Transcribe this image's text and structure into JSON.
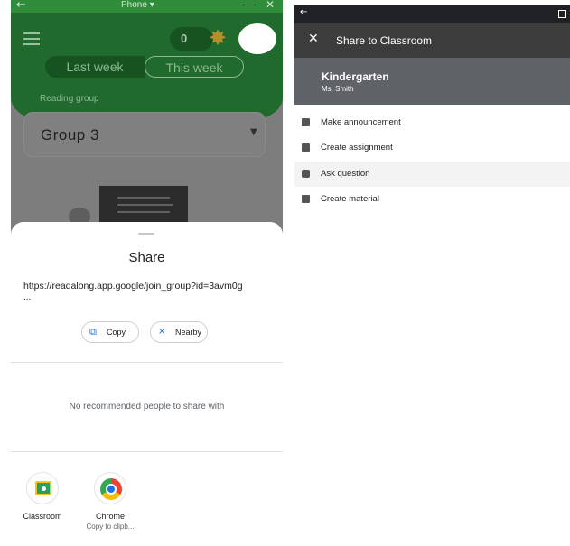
{
  "left_phone": {
    "status_bar": {
      "back_glyph": "←",
      "title": "Phone ▾",
      "minimize_glyph": "—",
      "close_glyph": "✕"
    },
    "header": {
      "coin_count": "0",
      "week_toggle": {
        "last_week": "Last week",
        "this_week": "This week"
      },
      "reading_group_label": "Reading group",
      "group_selector": {
        "value": "Group 3"
      }
    },
    "share_sheet": {
      "title": "Share",
      "url": "https://readalong.app.google/join_group?id=3avm0g",
      "url_overflow": "...",
      "actions": [
        {
          "label": "Copy",
          "icon": "copy-icon"
        },
        {
          "label": "Nearby",
          "icon": "nearby-icon"
        }
      ],
      "no_recommendations": "No recommended people to share with",
      "targets": [
        {
          "label": "Classroom",
          "sublabel": "",
          "icon": "google-classroom-icon"
        },
        {
          "label": "Chrome",
          "sublabel": "Copy to clipb...",
          "icon": "chrome-icon"
        }
      ]
    }
  },
  "right_phone": {
    "status_bar": {
      "back_glyph": "←"
    },
    "toolbar": {
      "close_glyph": "✕",
      "title": "Share to Classroom"
    },
    "class_card": {
      "name": "Kindergarten",
      "teacher": "Ms. Smith"
    },
    "options": [
      {
        "label": "Make announcement",
        "icon": "announcement-icon"
      },
      {
        "label": "Create assignment",
        "icon": "assignment-icon"
      },
      {
        "label": "Ask question",
        "icon": "question-icon"
      },
      {
        "label": "Create material",
        "icon": "material-icon"
      }
    ]
  },
  "colors": {
    "reading_green": "#1f6a2c",
    "scrim_gray": "#7d7d7d",
    "classroom_header": "#5f6368",
    "toolbar_dark": "#3c3c3c",
    "accent_blue": "#1a73e8"
  }
}
